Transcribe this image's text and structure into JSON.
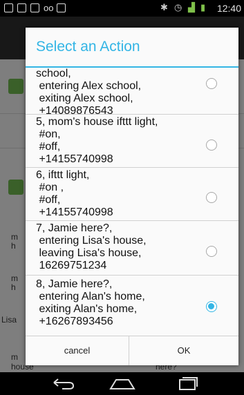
{
  "status_bar": {
    "time": "12:40",
    "left_icons": [
      "screenshot-icon",
      "image-icon",
      "gmail-icon",
      "voicemail-icon",
      "briefcase-icon"
    ],
    "right_icons": [
      "bluetooth-icon",
      "alarm-icon",
      "signal-icon",
      "battery-icon"
    ]
  },
  "dialog": {
    "title": "Select an Action",
    "items": [
      {
        "lines": [
          "school,",
          " entering Alex school,",
          " exiting Alex school,",
          " +14089876543"
        ],
        "checked": false
      },
      {
        "lines": [
          "5, mom's house ifttt light,",
          " #on,",
          " #off,",
          " +14155740998"
        ],
        "checked": false
      },
      {
        "lines": [
          "6, ifttt light,",
          " #on ,",
          " #off,",
          " +14155740998"
        ],
        "checked": false
      },
      {
        "lines": [
          "7, Jamie here?,",
          " entering Lisa's house,",
          " leaving Lisa's house,",
          " 16269751234"
        ],
        "checked": false
      },
      {
        "lines": [
          "8, Jamie here?,",
          " entering Alan's home,",
          " exiting Alan's home,",
          " +16267893456"
        ],
        "checked": true
      }
    ],
    "cancel_label": "cancel",
    "ok_label": "OK"
  },
  "background": {
    "texts": [
      "m",
      "h",
      "m",
      "h",
      "Lisa",
      "m",
      "house",
      "here?"
    ]
  },
  "accent_color": "#33b5e5"
}
